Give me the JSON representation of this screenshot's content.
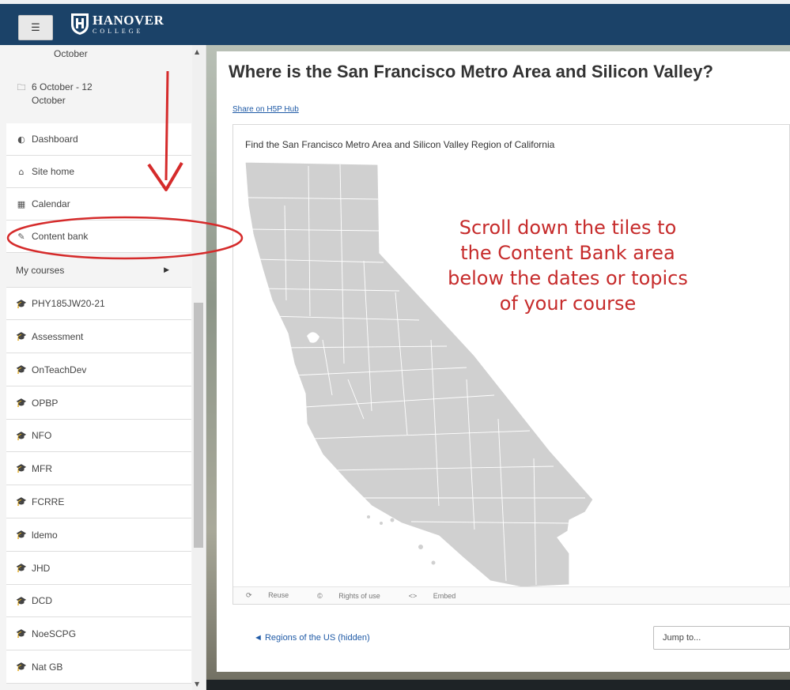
{
  "navbar": {
    "menu_icon": "hamburger-icon",
    "logo_name": "HANOVER",
    "logo_sub": "COLLEGE"
  },
  "sidebar": {
    "items": [
      {
        "label": "October",
        "icon": ""
      },
      {
        "label": "6 October - 12",
        "label2": "October",
        "icon": "folder-icon"
      },
      {
        "label": "Dashboard",
        "icon": "dashboard-icon"
      },
      {
        "label": "Site home",
        "icon": "home-icon"
      },
      {
        "label": "Calendar",
        "icon": "calendar-icon"
      },
      {
        "label": "Content bank",
        "icon": "brush-icon"
      },
      {
        "label": "My courses",
        "icon": ""
      },
      {
        "label": "PHY185JW20-21",
        "icon": "graduation-cap-icon"
      },
      {
        "label": "Assessment",
        "icon": "graduation-cap-icon"
      },
      {
        "label": "OnTeachDev",
        "icon": "graduation-cap-icon"
      },
      {
        "label": "OPBP",
        "icon": "graduation-cap-icon"
      },
      {
        "label": "NFO",
        "icon": "graduation-cap-icon"
      },
      {
        "label": "MFR",
        "icon": "graduation-cap-icon"
      },
      {
        "label": "FCRRE",
        "icon": "graduation-cap-icon"
      },
      {
        "label": "ldemo",
        "icon": "graduation-cap-icon"
      },
      {
        "label": "JHD",
        "icon": "graduation-cap-icon"
      },
      {
        "label": "DCD",
        "icon": "graduation-cap-icon"
      },
      {
        "label": "NoeSCPG",
        "icon": "graduation-cap-icon"
      },
      {
        "label": "Nat GB",
        "icon": "graduation-cap-icon"
      }
    ]
  },
  "main": {
    "title": "Where is the San Francisco Metro Area and Silicon Valley?",
    "share_link": "Share on H5P Hub",
    "h5p": {
      "task": "Find the San Francisco Metro Area and Silicon Valley Region of California",
      "footer": {
        "reuse": "Reuse",
        "rights": "Rights of use",
        "embed": "Embed"
      }
    },
    "prev_link": "◄ Regions of the US (hidden)",
    "jump_placeholder": "Jump to..."
  },
  "annotation": {
    "callout_lines": [
      "Scroll down the tiles to",
      "the Content Bank area",
      "below the dates or topics",
      "of your course"
    ],
    "color": "#c62b2b"
  },
  "colors": {
    "navbar": "#1b4268",
    "map_fill": "#d0d0d0",
    "link": "#1f5aa6"
  }
}
